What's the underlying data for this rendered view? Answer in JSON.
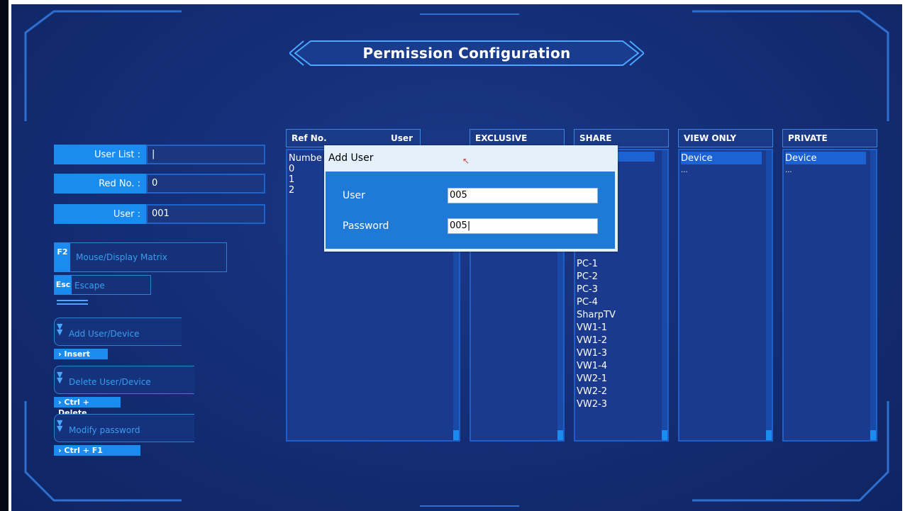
{
  "window": {
    "title": "Permission Configuration"
  },
  "left_panel": {
    "fields": [
      {
        "label": "User List :",
        "value": "|"
      },
      {
        "label": "Red No. :",
        "value": "0"
      },
      {
        "label": "User :",
        "value": "001"
      }
    ],
    "hotkeys": [
      {
        "key": "F2",
        "label": "Mouse/Display  Matrix"
      },
      {
        "key": "Esc",
        "label": "Escape"
      }
    ],
    "actions": [
      {
        "label": "Add User/Device",
        "shortcut": "Insert"
      },
      {
        "label": "Delete User/Device",
        "shortcut": "Ctrl + Delete"
      },
      {
        "label": "Modify password",
        "shortcut": "Ctrl + F1"
      }
    ]
  },
  "columns": {
    "ref": {
      "header_ref": "Ref No.",
      "header_user": "User",
      "rows": [
        "Numbe",
        "0",
        "1",
        "2"
      ]
    },
    "exclusive": {
      "header": "EXCLUSIVE",
      "rows": []
    },
    "share": {
      "header": "SHARE",
      "rows": [
        "PC-1",
        "PC-2",
        "PC-3",
        "PC-4",
        "SharpTV",
        "VW1-1",
        "VW1-2",
        "VW1-3",
        "VW1-4",
        "VW2-1",
        "VW2-2",
        "VW2-3"
      ]
    },
    "view_only": {
      "header": "VIEW ONLY",
      "rows": [
        "Device",
        "..."
      ]
    },
    "private": {
      "header": "PRIVATE",
      "rows": [
        "Device",
        "..."
      ]
    }
  },
  "dialog": {
    "title": "Add User",
    "user_label": "User",
    "user_value": "005",
    "password_label": "Password",
    "password_value": "005|"
  },
  "colors": {
    "background": "#15307a",
    "accent": "#1a8cf0",
    "border": "#1e5fc8"
  }
}
